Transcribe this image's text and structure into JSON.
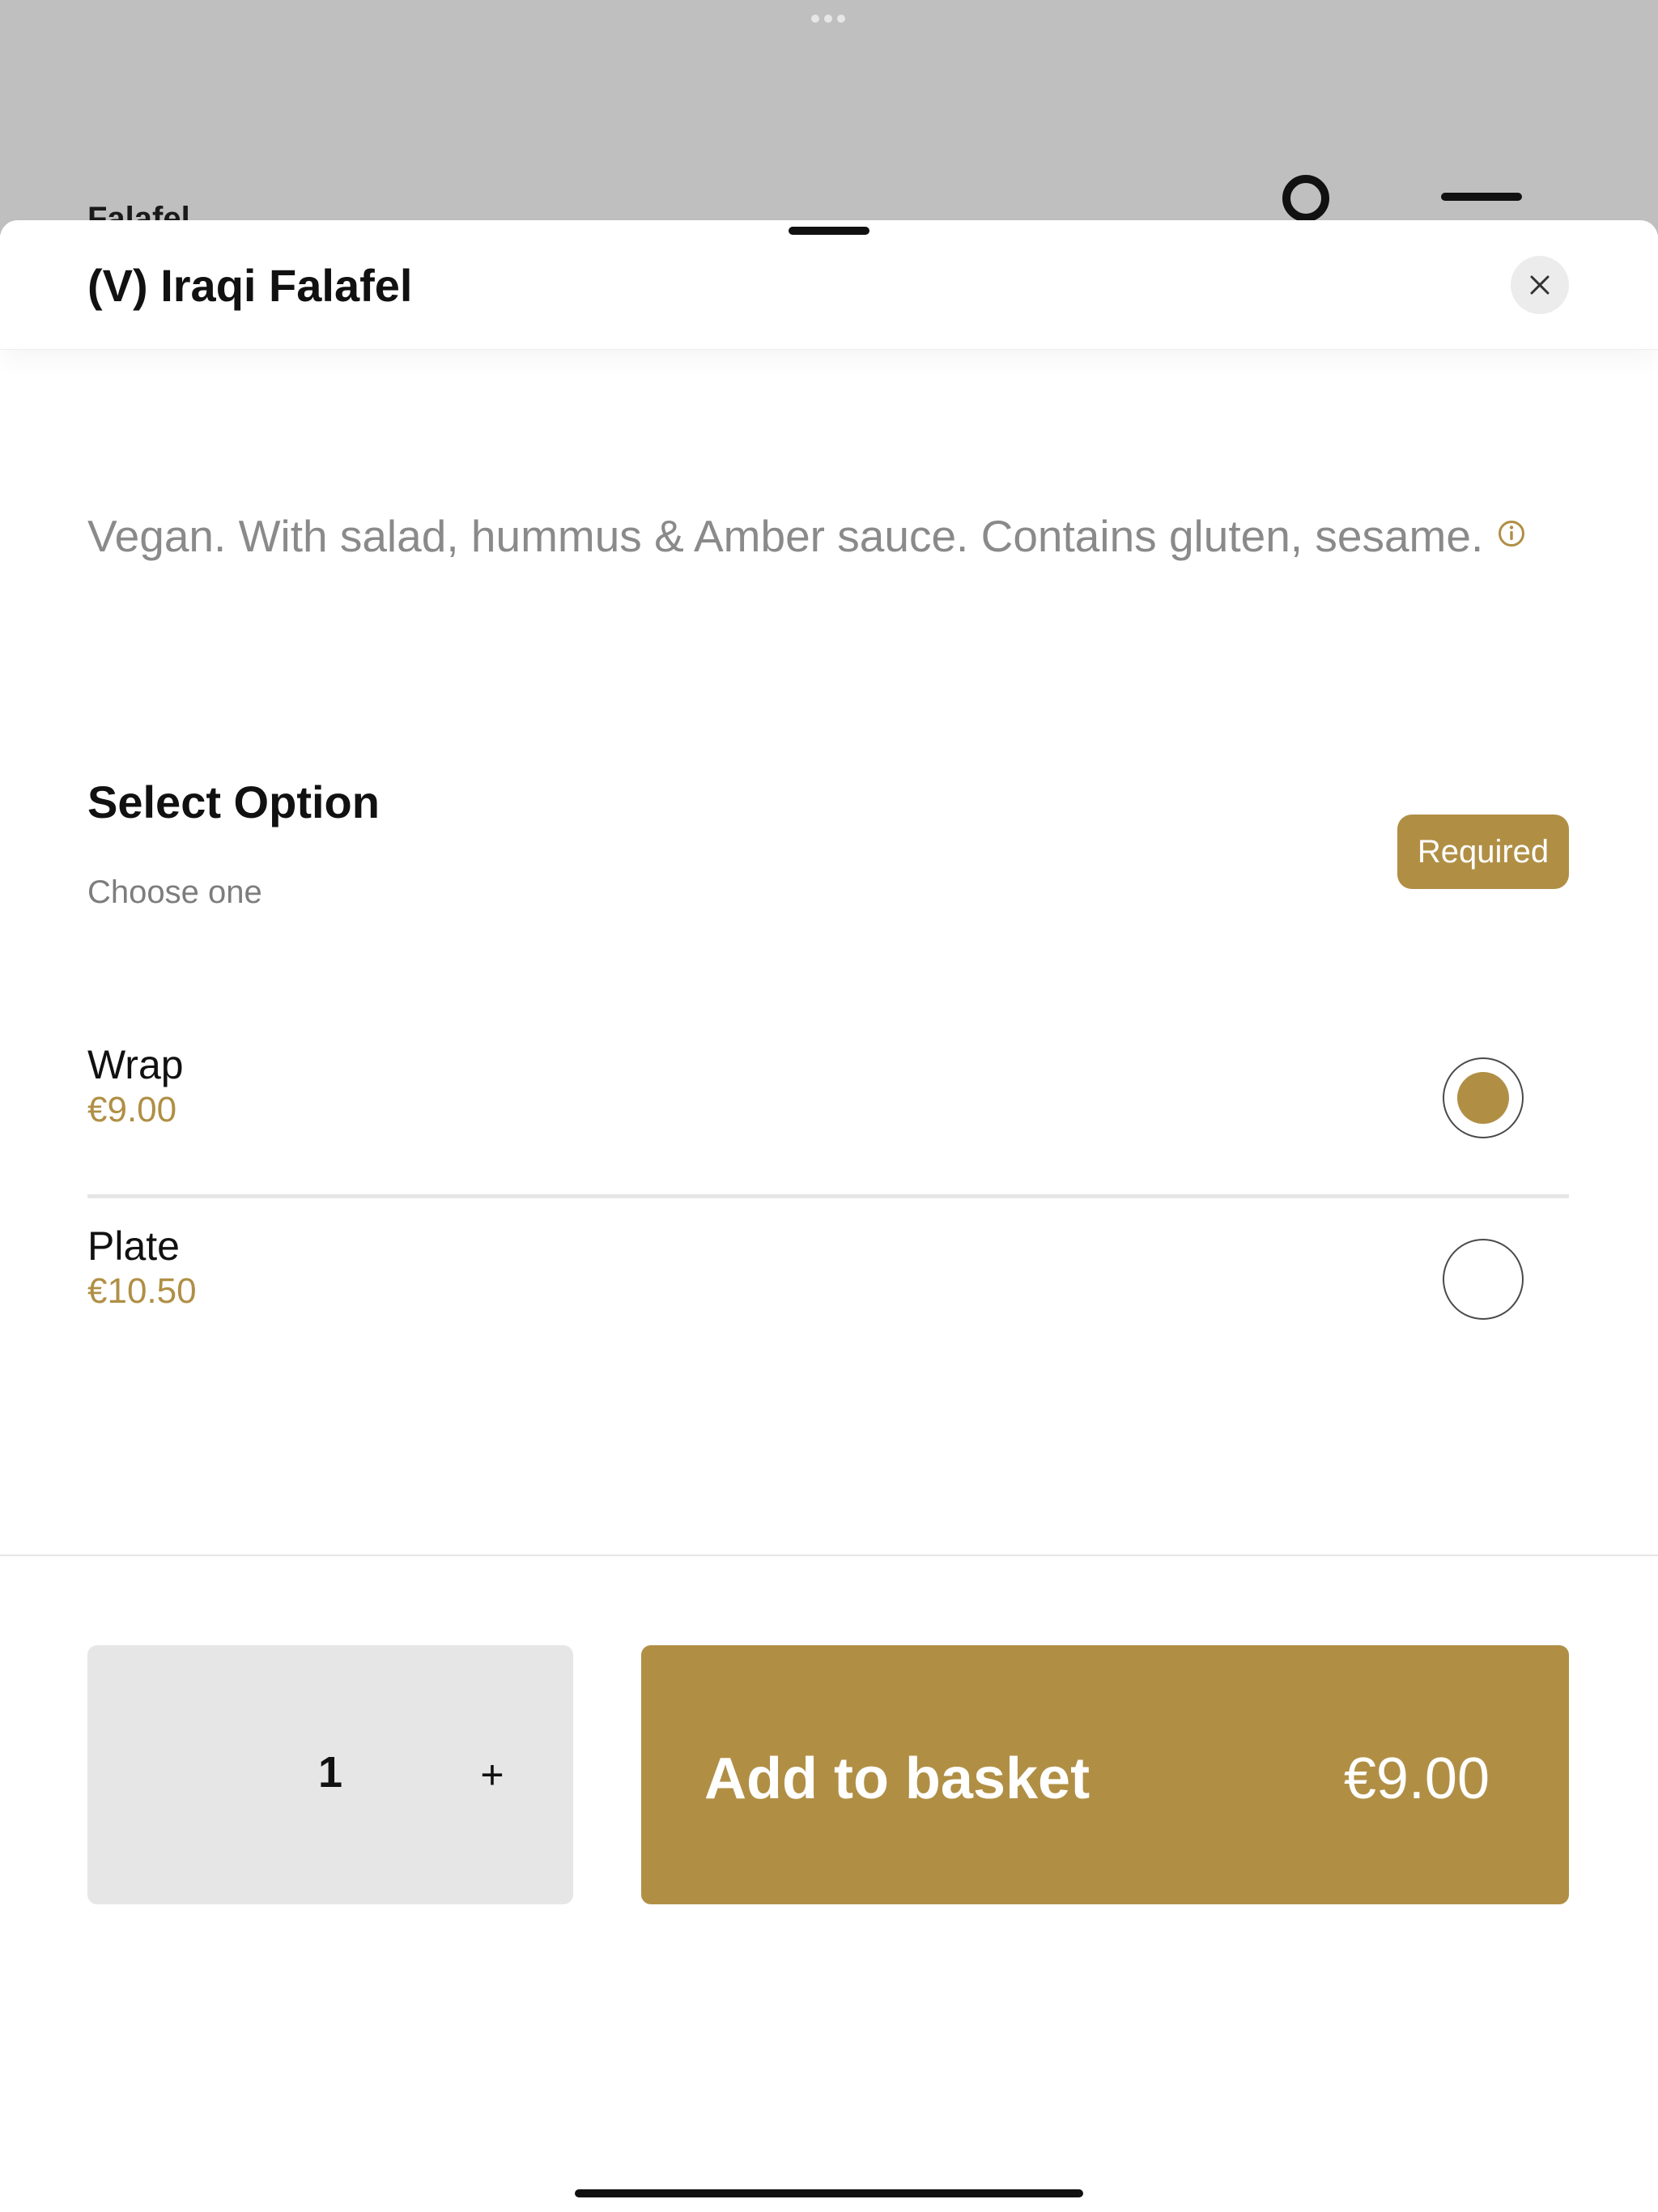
{
  "background": {
    "title": "Falafel",
    "account_icon": "account-icon",
    "menu_icon": "menu-icon"
  },
  "sheet": {
    "title": "(V) Iraqi Falafel",
    "close_icon": "close-icon",
    "description": "Vegan. With salad, hummus & Amber sauce. Contains gluten, sesame.",
    "info_icon": "info-icon"
  },
  "option_group": {
    "title": "Select Option",
    "hint": "Choose one",
    "badge": "Required",
    "options": [
      {
        "name": "Wrap",
        "price": "€9.00",
        "selected": true
      },
      {
        "name": "Plate",
        "price": "€10.50",
        "selected": false
      }
    ]
  },
  "footer": {
    "quantity": "1",
    "plus": "+",
    "add_label": "Add to basket",
    "add_price": "€9.00"
  },
  "colors": {
    "accent": "#b08f45",
    "backdrop": "#bfbfbf",
    "stepper_bg": "#e6e6e6"
  }
}
